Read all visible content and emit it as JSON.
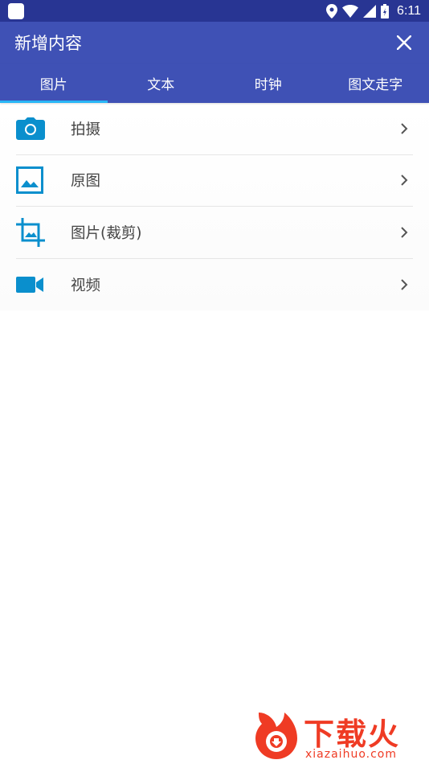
{
  "status_bar": {
    "time": "6:11"
  },
  "app_bar": {
    "title": "新增内容"
  },
  "tabs": [
    {
      "label": "图片",
      "active": true
    },
    {
      "label": "文本",
      "active": false
    },
    {
      "label": "时钟",
      "active": false
    },
    {
      "label": "图文走字",
      "active": false
    }
  ],
  "items": [
    {
      "label": "拍摄",
      "icon": "camera-icon"
    },
    {
      "label": "原图",
      "icon": "image-icon"
    },
    {
      "label": "图片(裁剪)",
      "icon": "crop-icon"
    },
    {
      "label": "视频",
      "icon": "video-icon"
    }
  ],
  "watermark": {
    "text": "下载火",
    "url": "xiazaihuo.com"
  },
  "colors": {
    "status": "#283593",
    "primary": "#3f51b5",
    "accent": "#29b6f6",
    "icon": "#0a8fcd"
  }
}
